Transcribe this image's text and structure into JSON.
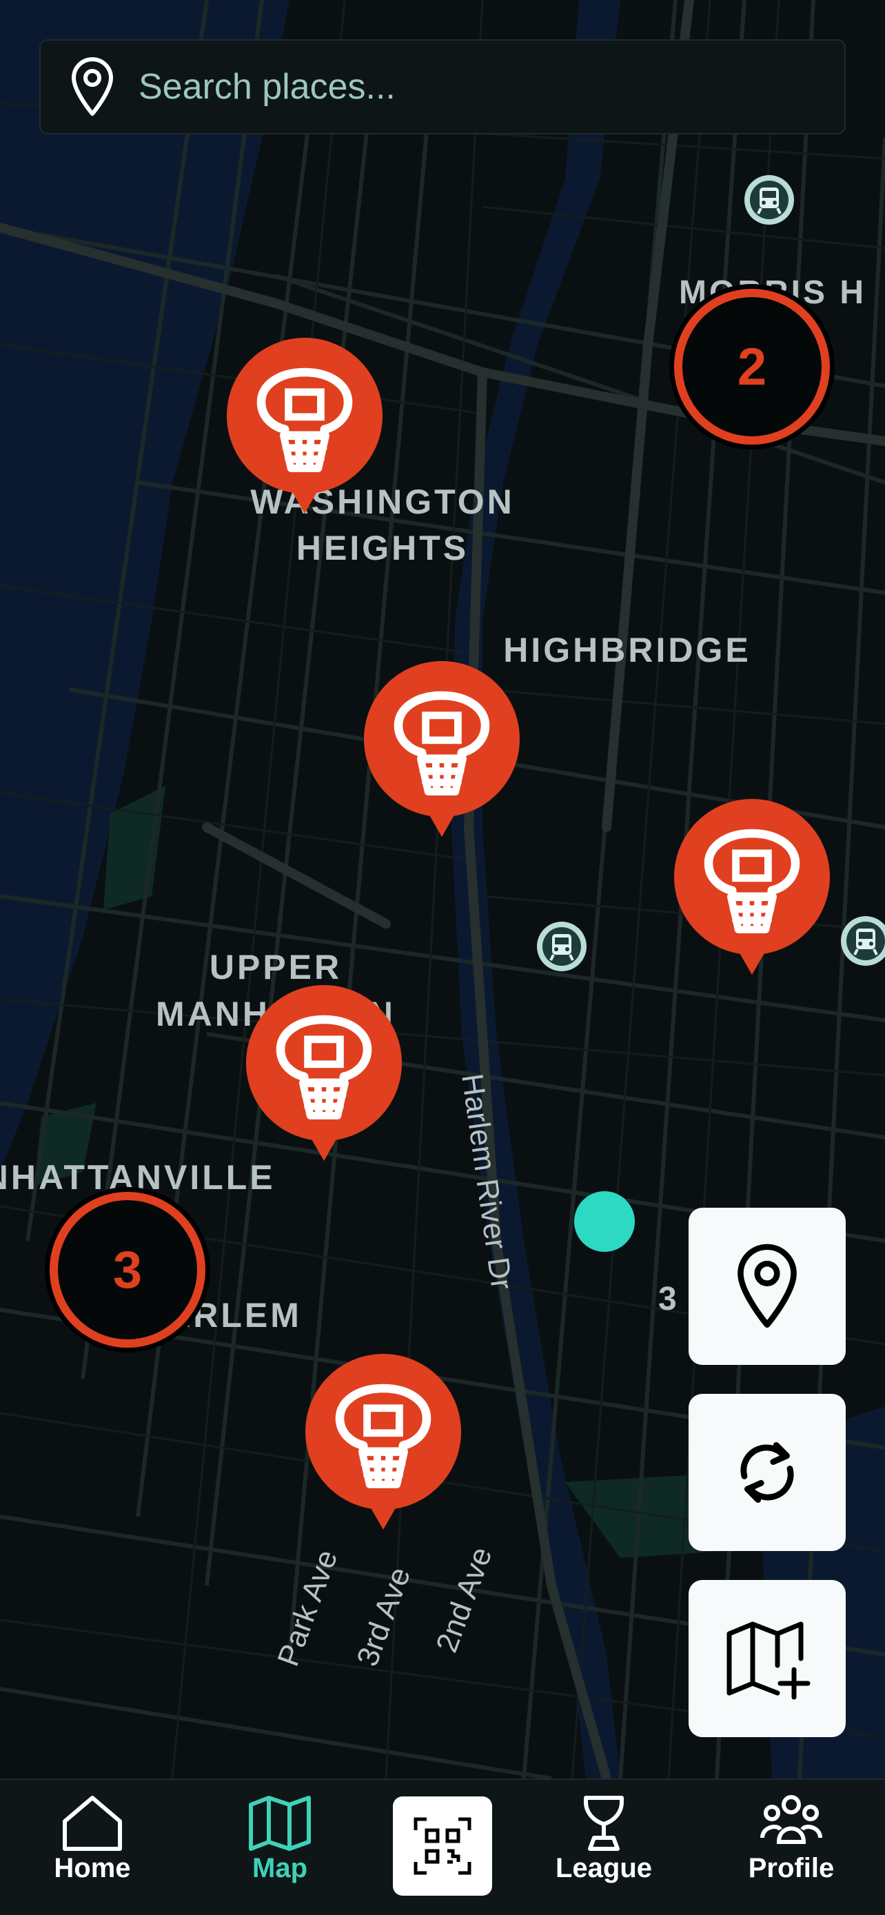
{
  "search": {
    "placeholder": "Search places..."
  },
  "map": {
    "labels": {
      "morris_heights": "MORRIS H",
      "washington_heights_1": "WASHINGTON",
      "washington_heights_2": "HEIGHTS",
      "highbridge": "HIGHBRIDGE",
      "upper_manhattan_1": "UPPER",
      "upper_manhattan_2": "MANHATTAN",
      "manhattanville": "MANHATTANVILLE",
      "harlem": "HARLEM",
      "harlem_river_dr": "Harlem River Dr",
      "park_ave": "Park Ave",
      "third_ave": "3rd Ave",
      "second_ave": "2nd Ave",
      "street_3": "3"
    },
    "clusters": [
      {
        "count": "2"
      },
      {
        "count": "3"
      }
    ],
    "colors": {
      "marker": "#e0401f",
      "user_location": "#2ed9c3",
      "background": "#0a1012"
    }
  },
  "nav": {
    "items": [
      {
        "label": "Home",
        "icon": "home-icon"
      },
      {
        "label": "Map",
        "icon": "map-icon",
        "active": true
      },
      {
        "label": "",
        "icon": "qr-code-icon"
      },
      {
        "label": "League",
        "icon": "trophy-icon"
      },
      {
        "label": "Profile",
        "icon": "people-icon"
      }
    ],
    "colors": {
      "active": "#3fd2b8",
      "inactive": "#ffffff"
    }
  }
}
